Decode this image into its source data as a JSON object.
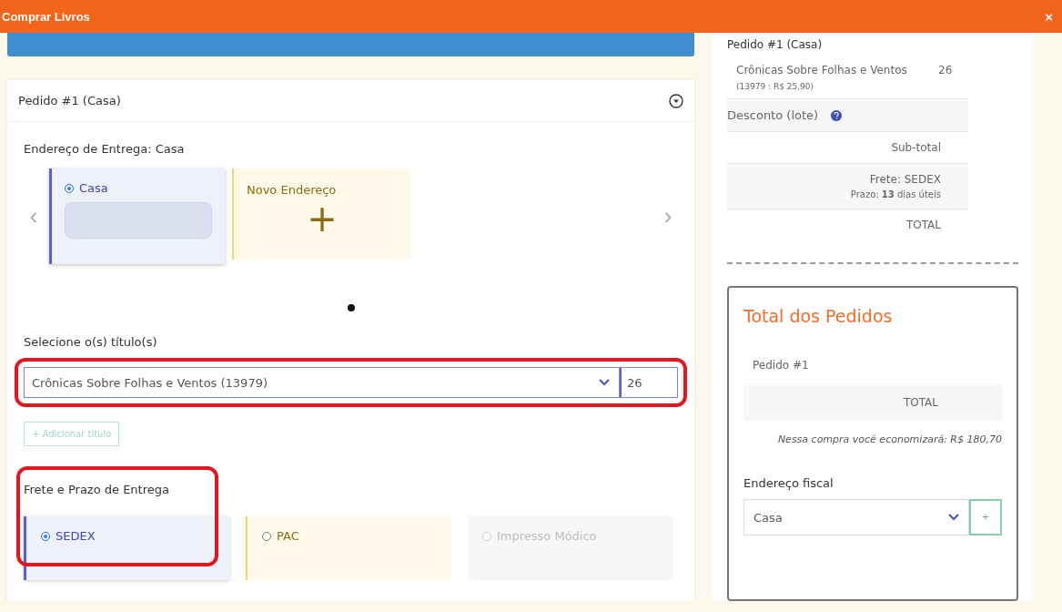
{
  "window": {
    "title": "Comprar Livros",
    "close": "×"
  },
  "order": {
    "title": "Pedido #1 (Casa)",
    "expanded": true,
    "delivery": {
      "label": "Endereço de Entrega: Casa",
      "prev": "‹",
      "next": "›",
      "addresses": [
        {
          "kind": "address",
          "label": "Casa",
          "selected": true
        },
        {
          "kind": "new",
          "label": "Novo Endereço",
          "icon": "+",
          "selected": false
        }
      ]
    },
    "titles": {
      "label": "Selecione o(s) título(s)",
      "value": "Crônicas Sobre Folhas e Ventos (13979)",
      "quantity": "26",
      "add_button": "+ Adicionar título"
    },
    "shipping": {
      "label": "Frete e Prazo de Entrega",
      "options": [
        {
          "name": "SEDEX",
          "selected": true,
          "disabled": false
        },
        {
          "name": "PAC",
          "selected": false,
          "disabled": false
        },
        {
          "name": "Impresso Módico",
          "selected": false,
          "disabled": true
        }
      ]
    }
  },
  "summary": {
    "title": "Pedido #1 (Casa)",
    "item": {
      "name": "Crônicas Sobre Folhas e Ventos",
      "quantity": "26",
      "detail": "(13979 : R$ 25,90)"
    },
    "discount": "Desconto (lote)",
    "subtotal": "Sub-total",
    "shipping": "Frete: SEDEX",
    "deadline": "Prazo: **13** dias úteis",
    "total": "TOTAL"
  },
  "totals": {
    "title": "Total dos Pedidos",
    "order": "Pedido #1",
    "total": "TOTAL",
    "savings": "Nessa compra você economizará: R$ 180,70",
    "fiscal_label": "Endereço fiscal",
    "fiscal_value": "Casa",
    "add_button": "+"
  }
}
